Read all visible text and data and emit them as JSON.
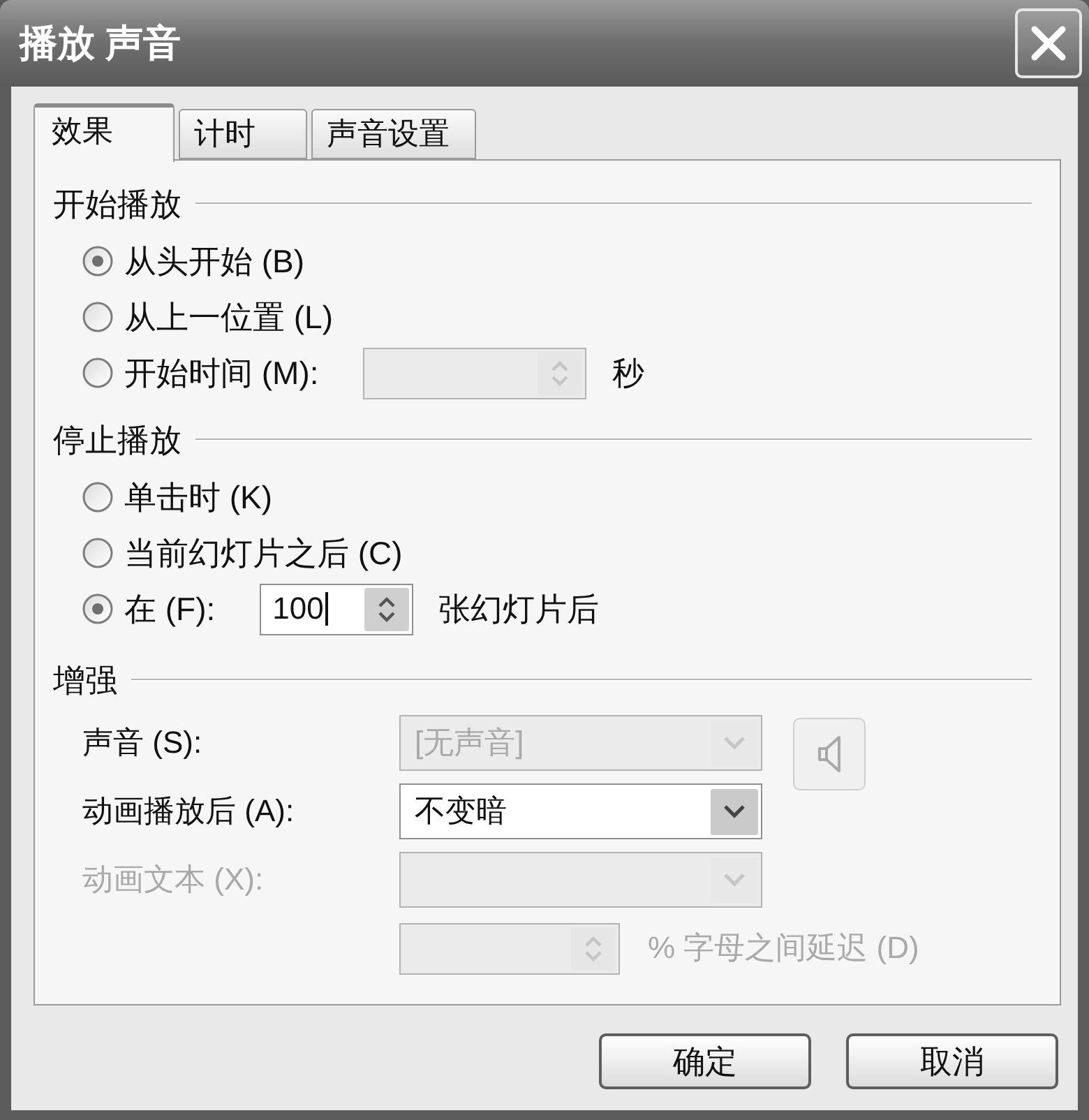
{
  "window": {
    "title": "播放 声音"
  },
  "tabs": [
    {
      "label": "效果",
      "selected": true
    },
    {
      "label": "计时",
      "selected": false
    },
    {
      "label": "声音设置",
      "selected": false
    }
  ],
  "sections": [
    {
      "title": "开始播放",
      "rows": [
        {
          "kind": "radio",
          "label": "从头开始 (B)",
          "selected": true
        },
        {
          "kind": "radio",
          "label": "从上一位置 (L)",
          "selected": false
        },
        {
          "kind": "radio",
          "label": "开始时间 (M):",
          "selected": false,
          "spinner": {
            "disabled": true
          },
          "suffix": {
            "text": "秒",
            "disabled": false
          }
        }
      ]
    },
    {
      "title": "停止播放",
      "rows": [
        {
          "kind": "radio",
          "label": "单击时 (K)",
          "selected": false
        },
        {
          "kind": "radio",
          "label": "当前幻灯片之后 (C)",
          "selected": false
        },
        {
          "kind": "radio",
          "label": "在 (F):",
          "selected": true,
          "spinner": {
            "value": "100",
            "disabled": false,
            "focused": true
          },
          "suffix": {
            "text": "张幻灯片后",
            "disabled": false
          }
        }
      ]
    },
    {
      "title": "增强",
      "rows": [
        {
          "kind": "combo",
          "label": {
            "text": "声音 (S):",
            "disabled": false
          },
          "combo": {
            "value": "[无声音]",
            "disabled": true
          },
          "speaker_button": {
            "disabled": true
          }
        },
        {
          "kind": "combo",
          "label": {
            "text": "动画播放后 (A):",
            "disabled": false
          },
          "combo": {
            "value": "不变暗",
            "disabled": false
          }
        },
        {
          "kind": "combo",
          "label": {
            "text": "动画文本 (X):",
            "disabled": true
          },
          "combo": {
            "disabled": true
          }
        },
        {
          "kind": "spinner",
          "spinner": {
            "disabled": true
          },
          "suffix": {
            "text": "% 字母之间延迟 (D)",
            "disabled": true
          }
        }
      ]
    }
  ],
  "buttons": [
    {
      "label": "确定"
    },
    {
      "label": "取消"
    }
  ]
}
